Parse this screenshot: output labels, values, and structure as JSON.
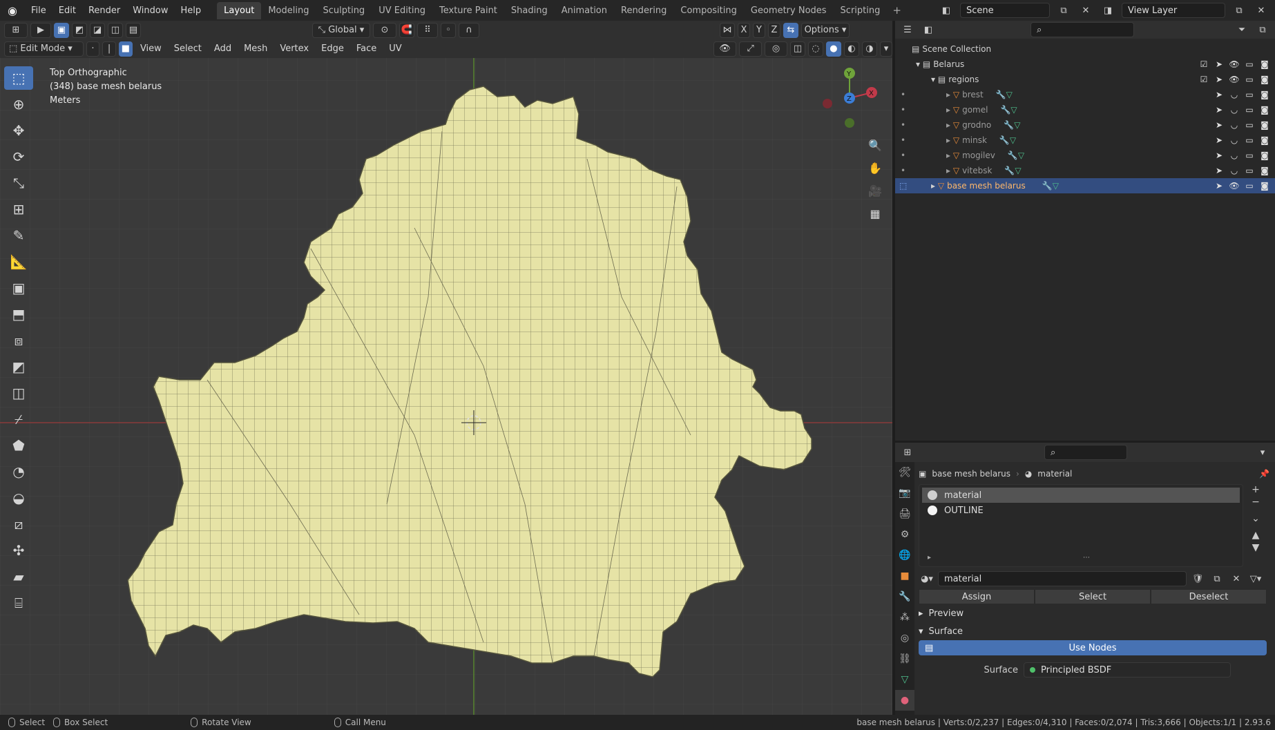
{
  "app": {
    "logo_icon": "blender-logo-icon"
  },
  "menu": [
    "File",
    "Edit",
    "Render",
    "Window",
    "Help"
  ],
  "workspaces": [
    "Layout",
    "Modeling",
    "Sculpting",
    "UV Editing",
    "Texture Paint",
    "Shading",
    "Animation",
    "Rendering",
    "Compositing",
    "Geometry Nodes",
    "Scripting"
  ],
  "active_workspace": "Layout",
  "scene": {
    "name": "Scene",
    "view_layer": "View Layer"
  },
  "viewport": {
    "mode": "Edit Mode",
    "menus": [
      "View",
      "Select",
      "Add",
      "Mesh",
      "Vertex",
      "Edge",
      "Face",
      "UV"
    ],
    "orientation": "Global",
    "options": "Options",
    "overlay_lines": [
      "Top Orthographic",
      "(348) base mesh belarus",
      "Meters"
    ],
    "mesh_fill": "#e6e3a6",
    "mesh_wire": "#4a4a3a",
    "gizmo": {
      "y": "Y",
      "z": "Z",
      "x": "X"
    },
    "axis_labels": [
      "X",
      "Y",
      "Z"
    ]
  },
  "outliner": {
    "root": "Scene Collection",
    "collection": "Belarus",
    "subcollection": "regions",
    "regions": [
      "brest",
      "gomel",
      "grodno",
      "minsk",
      "mogilev",
      "vitebsk"
    ],
    "selected": "base mesh belarus"
  },
  "properties": {
    "object": "base mesh belarus",
    "material_crumb": "material",
    "slots": [
      {
        "name": "material",
        "color": "#cfcfcf"
      },
      {
        "name": "OUTLINE",
        "color": "#f4f4f4"
      }
    ],
    "material_name": "material",
    "buttons": [
      "Assign",
      "Select",
      "Deselect"
    ],
    "panels": {
      "preview": "Preview",
      "surface": "Surface"
    },
    "use_nodes": "Use Nodes",
    "surface_label": "Surface",
    "surface_value": "Principled BSDF"
  },
  "statusbar": {
    "select": "Select",
    "box_select": "Box Select",
    "rotate": "Rotate View",
    "call_menu": "Call Menu",
    "stats": "base mesh belarus | Verts:0/2,237 | Edges:0/4,310 | Faces:0/2,074 | Tris:3,666 | Objects:1/1 | 2.93.6"
  }
}
